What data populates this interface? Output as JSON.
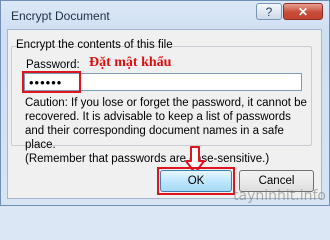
{
  "window": {
    "title": "Encrypt Document",
    "controls": {
      "help": "?",
      "close": "✕"
    }
  },
  "group": {
    "legend": "Encrypt the contents of this file"
  },
  "password": {
    "label": "Password:",
    "value": "••••••"
  },
  "annotation": {
    "text": "Đặt mật khẩu",
    "color": "#e01010"
  },
  "caution": "Caution: If you lose or forget the password, it cannot be recovered. It is advisable to keep a list of passwords and their corresponding document names in a safe place.\n(Remember that passwords are case-sensitive.)",
  "buttons": {
    "ok": "OK",
    "cancel": "Cancel"
  },
  "watermark": "tayninhit.info",
  "icons": {
    "arrow": "down-arrow-icon"
  }
}
